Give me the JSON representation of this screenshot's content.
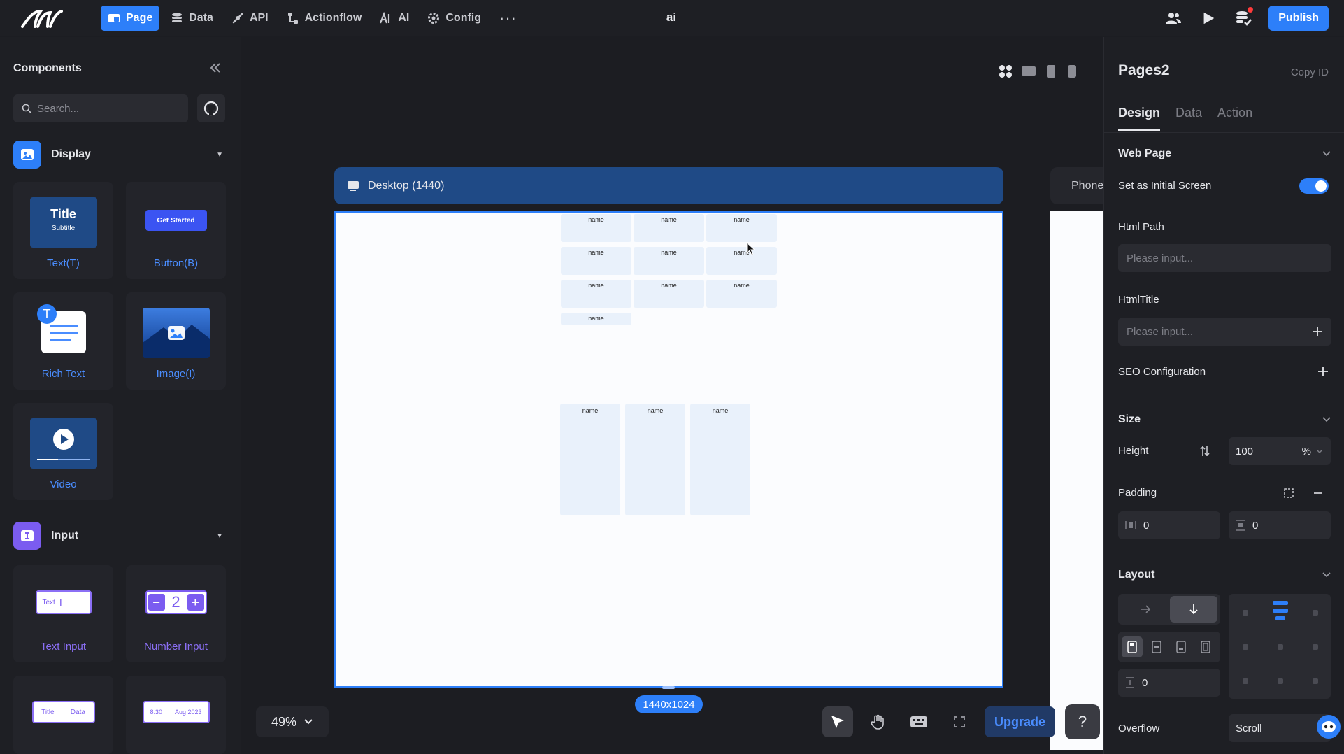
{
  "topbar": {
    "nav": [
      {
        "label": "Page",
        "icon": "page-icon",
        "active": true
      },
      {
        "label": "Data",
        "icon": "database-icon",
        "active": false
      },
      {
        "label": "API",
        "icon": "api-icon",
        "active": false
      },
      {
        "label": "Actionflow",
        "icon": "actionflow-icon",
        "active": false
      },
      {
        "label": "AI",
        "icon": "ai-icon",
        "active": false
      },
      {
        "label": "Config",
        "icon": "gear-icon",
        "active": false
      }
    ],
    "more": "···",
    "project_name": "ai",
    "publish_label": "Publish"
  },
  "left": {
    "title": "Components",
    "search_placeholder": "Search...",
    "display_section": "Display",
    "input_section": "Input",
    "display_cards": [
      {
        "label": "Text(T)",
        "thumb_title": "Title",
        "thumb_subtitle": "Subtitle"
      },
      {
        "label": "Button(B)",
        "thumb_text": "Get Started"
      },
      {
        "label": "Rich Text",
        "badge": "T"
      },
      {
        "label": "Image(I)"
      },
      {
        "label": "Video"
      }
    ],
    "input_cards": [
      {
        "label": "Text Input",
        "thumb_text": "Text"
      },
      {
        "label": "Number Input",
        "thumb_value": "2"
      },
      {
        "thumb_a": "Title",
        "thumb_b": "Data"
      },
      {
        "thumb_a": "8:30",
        "thumb_b": "Aug 2023"
      }
    ]
  },
  "canvas": {
    "frame_label": "Desktop (1440)",
    "frame2_label": "Phone",
    "cell_label": "name",
    "size_label": "1440x1024",
    "zoom": "49%",
    "upgrade_label": "Upgrade",
    "help_label": "?"
  },
  "right": {
    "title": "Pages2",
    "copy_id": "Copy ID",
    "tabs": [
      "Design",
      "Data",
      "Action"
    ],
    "web_page": "Web Page",
    "initial_screen": "Set as Initial Screen",
    "initial_screen_on": true,
    "html_path": "Html Path",
    "html_path_placeholder": "Please input...",
    "html_title": "HtmlTitle",
    "html_title_placeholder": "Please input...",
    "seo": "SEO Configuration",
    "size": "Size",
    "height_label": "Height",
    "height_value": "100",
    "height_unit": "%",
    "padding_label": "Padding",
    "padding_h": "0",
    "padding_v": "0",
    "layout": "Layout",
    "gap_value": "0",
    "overflow_label": "Overflow",
    "overflow_value": "Scroll"
  },
  "colors": {
    "accent": "#2d7ff9",
    "frame_header": "#1f4a86",
    "cell": "#e9f1fb"
  }
}
